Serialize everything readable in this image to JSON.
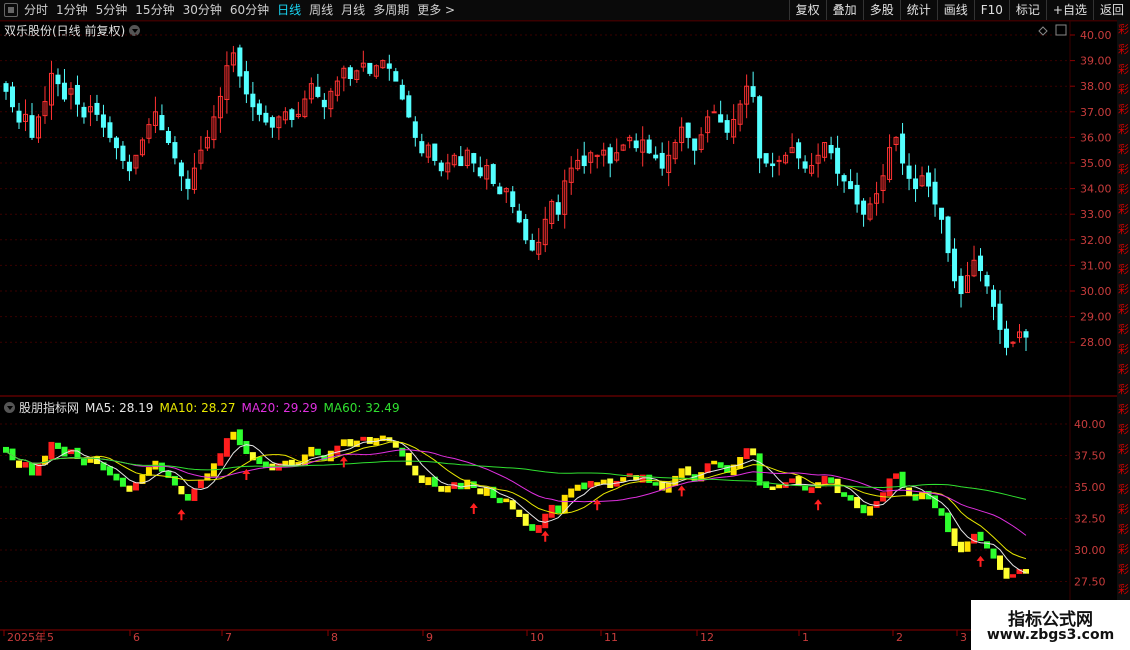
{
  "toolbar": {
    "periods": [
      "分时",
      "1分钟",
      "5分钟",
      "15分钟",
      "30分钟",
      "60分钟",
      "日线",
      "周线",
      "月线",
      "多周期",
      "更多 >"
    ],
    "active_period": "日线",
    "buttons": [
      "复权",
      "叠加",
      "多股",
      "统计",
      "画线",
      "F10",
      "标记",
      "+自选",
      "返回"
    ]
  },
  "main_chart": {
    "title": "双乐股份(日线 前复权)",
    "price_ticks": [
      "40.00",
      "39.00",
      "38.00",
      "37.00",
      "36.00",
      "35.00",
      "34.00",
      "33.00",
      "32.00",
      "31.00",
      "30.00",
      "29.00",
      "28.00"
    ]
  },
  "indicator": {
    "name": "股朋指标网",
    "ma5": "MA5: 28.19",
    "ma10": "MA10: 28.27",
    "ma20": "MA20: 29.29",
    "ma60": "MA60: 32.49",
    "ticks": [
      "40.00",
      "37.50",
      "35.00",
      "32.50",
      "30.00",
      "27.50"
    ]
  },
  "time_axis": [
    "2025年",
    "5",
    "6",
    "7",
    "8",
    "9",
    "10",
    "11",
    "12",
    "1",
    "2",
    "3"
  ],
  "right_panel_chars": "彩彩彩彩彩彩彩彩彩彩彩彩彩彩彩彩彩彩彩彩彩彩彩彩彩彩彩彩彩彩彩",
  "watermark": {
    "line1": "指标公式网",
    "line2": "www.zbgs3.com"
  },
  "colors": {
    "up": "#ff3232",
    "down": "#54ffff",
    "grid": "#3a0000",
    "ma5": "#e6e6e6",
    "ma10": "#e8e800",
    "ma20": "#e030e0",
    "ma60": "#30e030",
    "arrow": "#ff2020"
  },
  "chart_data": {
    "type": "candlestick",
    "title": "双乐股份(日线 前复权)",
    "ylim": [
      27,
      40.5
    ],
    "closes": [
      37.8,
      37.2,
      36.6,
      36.9,
      36.0,
      36.8,
      37.4,
      38.5,
      38.1,
      37.5,
      37.9,
      37.3,
      36.8,
      37.2,
      36.9,
      36.4,
      36.0,
      35.6,
      35.1,
      34.7,
      35.3,
      35.9,
      36.5,
      37.0,
      36.3,
      35.8,
      35.2,
      34.5,
      34.0,
      34.8,
      35.5,
      36.0,
      36.8,
      37.6,
      38.8,
      39.3,
      38.4,
      37.7,
      37.2,
      36.9,
      36.6,
      36.4,
      36.8,
      37.0,
      36.7,
      36.9,
      37.5,
      38.1,
      37.6,
      37.2,
      37.8,
      38.2,
      38.7,
      38.3,
      38.6,
      38.9,
      38.5,
      38.8,
      39.0,
      38.7,
      38.2,
      37.5,
      36.8,
      36.0,
      35.4,
      35.7,
      35.1,
      34.7,
      35.0,
      35.3,
      34.9,
      35.5,
      35.0,
      34.5,
      34.9,
      34.2,
      33.8,
      34.0,
      33.3,
      32.7,
      32.0,
      31.6,
      31.9,
      32.8,
      33.5,
      33.0,
      34.3,
      34.8,
      35.1,
      34.9,
      35.4,
      35.3,
      35.5,
      35.0,
      35.4,
      35.7,
      36.0,
      35.6,
      35.9,
      35.4,
      35.2,
      34.8,
      35.3,
      35.8,
      36.4,
      36.0,
      35.5,
      36.1,
      36.8,
      37.0,
      36.6,
      36.2,
      36.7,
      37.3,
      38.0,
      37.6,
      35.2,
      35.0,
      34.9,
      35.1,
      35.3,
      35.6,
      35.2,
      34.8,
      34.9,
      35.3,
      35.8,
      35.4,
      34.6,
      34.3,
      34.0,
      33.4,
      33.0,
      33.4,
      33.8,
      34.5,
      35.6,
      36.0,
      35.0,
      34.4,
      34.0,
      34.5,
      34.1,
      33.4,
      32.8,
      31.5,
      30.4,
      29.9,
      30.6,
      31.2,
      30.8,
      30.2,
      29.4,
      28.5,
      27.8,
      28.0,
      28.4,
      28.2
    ]
  }
}
